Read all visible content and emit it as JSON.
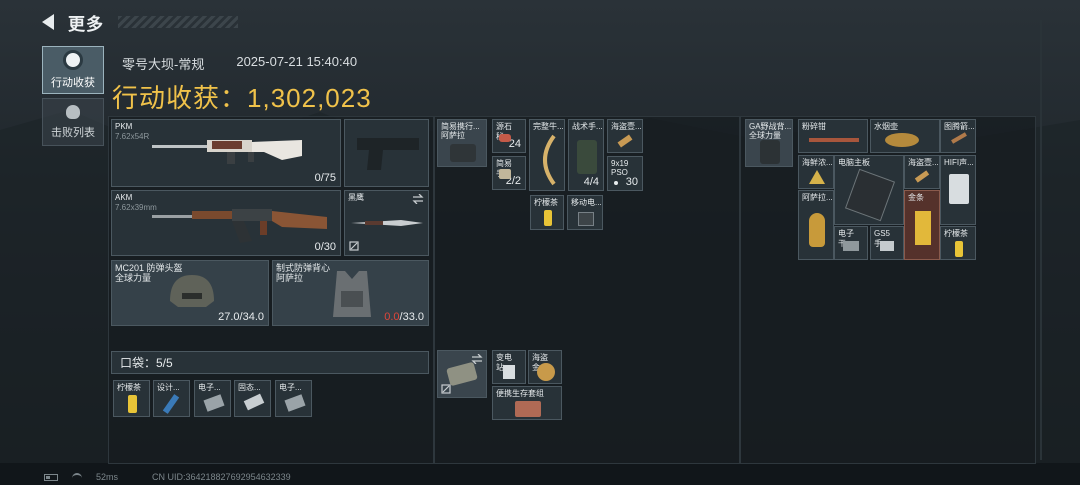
{
  "header": {
    "title": "更多"
  },
  "tabs": [
    {
      "label": "行动收获",
      "active": true
    },
    {
      "label": "击败列表",
      "active": false
    }
  ],
  "session": {
    "map": "零号大坝-常规",
    "datetime": "2025-07-21 15:40:40"
  },
  "haul": {
    "label": "行动收获：",
    "value": "1,302,023"
  },
  "loadout": {
    "primary": {
      "name": "PKM",
      "caliber": "7.62x54R",
      "ammo": "0/75"
    },
    "secondary": {
      "name": "AKM",
      "caliber": "7.62x39mm",
      "ammo": "0/30"
    },
    "melee": {
      "name": "黑鹰"
    },
    "helmet": {
      "name": "MC201 防弹头盔",
      "maker": "全球力量",
      "durability": "27.0/34.0"
    },
    "armor": {
      "name": "制式防弹背心",
      "maker": "阿萨拉",
      "durability_current": "0.0",
      "durability_max": "/33.0"
    }
  },
  "pouch": {
    "label": "口袋：5/5",
    "items": [
      {
        "name": "柠檬茶"
      },
      {
        "name": "设计..."
      },
      {
        "name": "电子..."
      },
      {
        "name": "固态..."
      },
      {
        "name": "电子..."
      }
    ]
  },
  "chest_rig": {
    "items": [
      {
        "name": "简易携行...",
        "sub": "阿萨拉"
      },
      {
        "name": "源石秘...",
        "count": "24"
      },
      {
        "name": "简易手...",
        "count": "2/2"
      },
      {
        "name": "完整牛..."
      },
      {
        "name": "战术手...",
        "count": "4/4"
      },
      {
        "name": "海盗壹..."
      },
      {
        "name": "9x19",
        "sub": "PSO",
        "count": "30"
      },
      {
        "name": "柠檬茶"
      },
      {
        "name": "移动电..."
      }
    ]
  },
  "backpack_small": {
    "items": [
      {
        "name": "变电站..."
      },
      {
        "name": "海盗金..."
      },
      {
        "name": "便携生存套组"
      }
    ]
  },
  "backpack": {
    "container": {
      "name": "GA野战背...",
      "maker": "全球力量"
    },
    "items": [
      {
        "name": "粉碎钳"
      },
      {
        "name": "水烟壶"
      },
      {
        "name": "图腾箭..."
      },
      {
        "name": "海鲜浓..."
      },
      {
        "name": "电脑主板"
      },
      {
        "name": "海盗壹..."
      },
      {
        "name": "HIFI声..."
      },
      {
        "name": "阿萨拉..."
      },
      {
        "name": "金条"
      },
      {
        "name": "电子干..."
      },
      {
        "name": "GS5手..."
      },
      {
        "name": "柠檬茶"
      }
    ]
  },
  "footer": {
    "ping": "52ms",
    "uid": "CN UID:364218827692954632339"
  },
  "colors": {
    "accent_gold": "#f0c24a",
    "danger": "#e0453a",
    "gold_slot": "#5c342c"
  }
}
